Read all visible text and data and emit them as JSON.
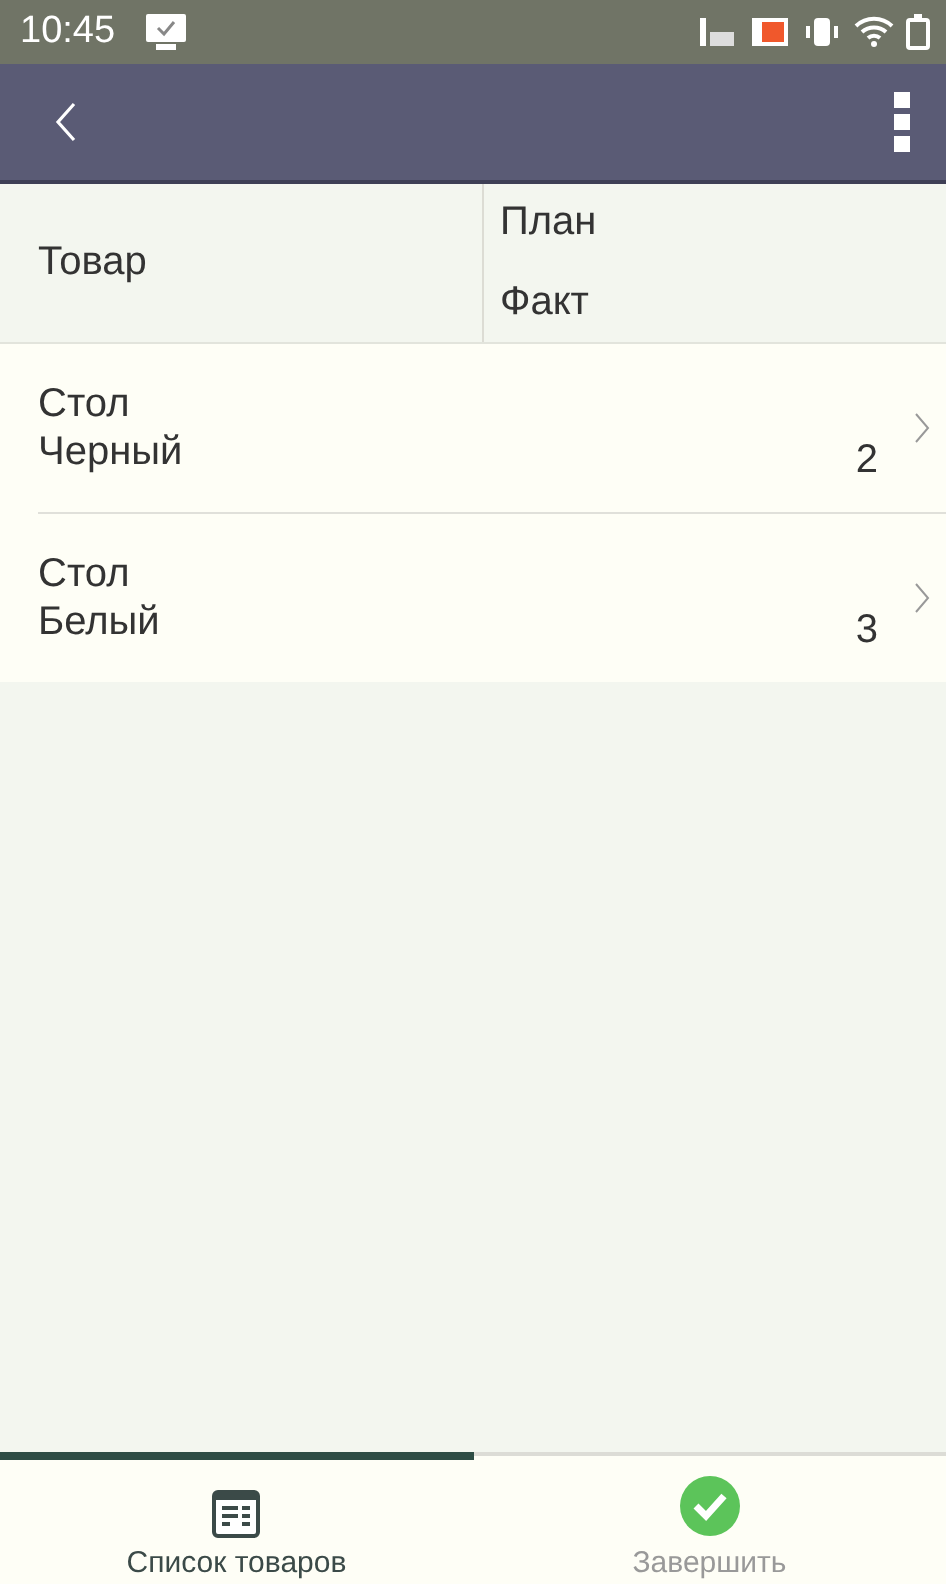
{
  "status_bar": {
    "time": "10:45"
  },
  "table": {
    "columns": [
      {
        "label": "Товар"
      },
      {
        "labels": [
          "План",
          "Факт"
        ]
      }
    ],
    "rows": [
      {
        "name": "Стол\nЧерный",
        "fact": "2"
      },
      {
        "name": "Стол\nБелый",
        "fact": "3"
      }
    ]
  },
  "tabs": [
    {
      "label": "Список товаров",
      "kind": "list",
      "selected": true
    },
    {
      "label": "Завершить",
      "kind": "done",
      "selected": false
    }
  ]
}
